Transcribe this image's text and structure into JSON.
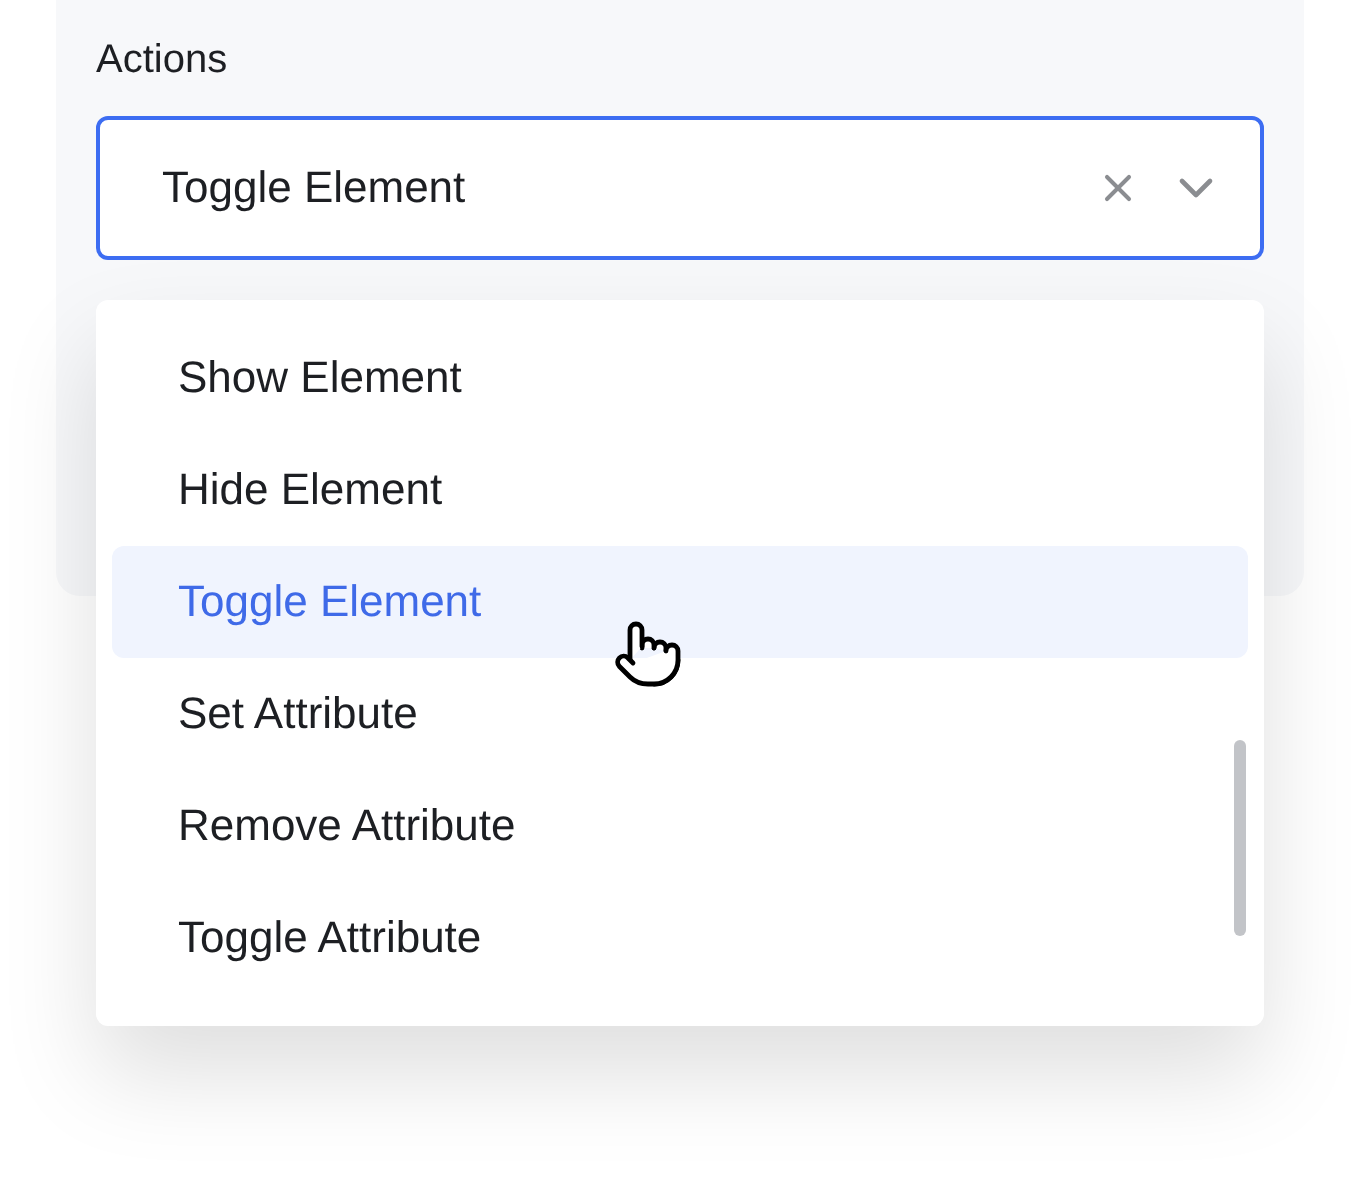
{
  "field": {
    "label": "Actions",
    "value": "Toggle Element"
  },
  "dropdown": {
    "options": [
      {
        "label": "Show Element",
        "selected": false
      },
      {
        "label": "Hide Element",
        "selected": false
      },
      {
        "label": "Toggle Element",
        "selected": true
      },
      {
        "label": "Set Attribute",
        "selected": false
      },
      {
        "label": "Remove Attribute",
        "selected": false
      },
      {
        "label": "Toggle Attribute",
        "selected": false
      }
    ]
  }
}
